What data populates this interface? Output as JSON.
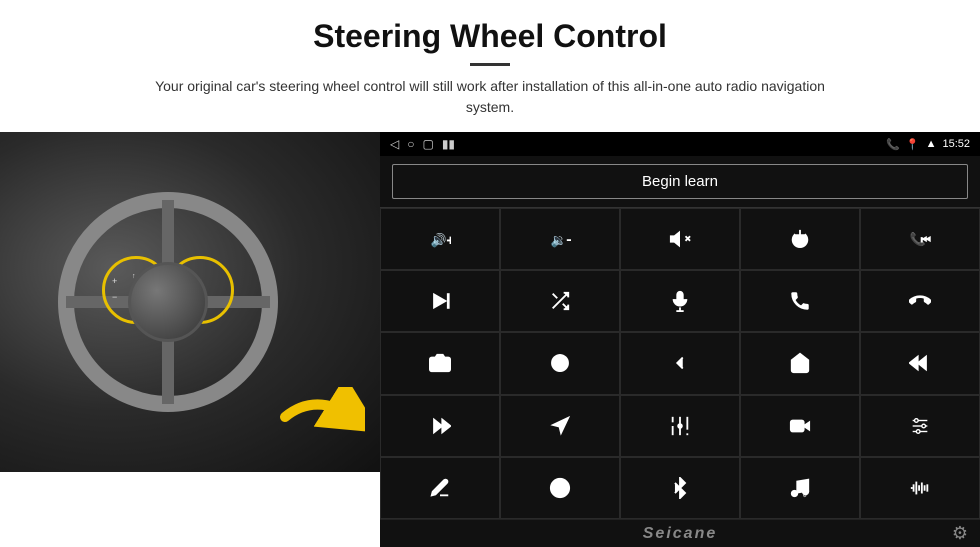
{
  "header": {
    "title": "Steering Wheel Control",
    "subtitle": "Your original car's steering wheel control will still work after installation of this all-in-one auto radio navigation system."
  },
  "status_bar": {
    "time": "15:52",
    "phone_icon": "📞",
    "location_icon": "📍",
    "wifi_icon": "📶"
  },
  "begin_learn": {
    "label": "Begin learn"
  },
  "controls": [
    {
      "id": "vol-up",
      "icon": "vol_up"
    },
    {
      "id": "vol-down",
      "icon": "vol_down"
    },
    {
      "id": "mute",
      "icon": "mute"
    },
    {
      "id": "power",
      "icon": "power"
    },
    {
      "id": "prev-track",
      "icon": "prev_track"
    },
    {
      "id": "next-track",
      "icon": "next_track"
    },
    {
      "id": "shuffle",
      "icon": "shuffle"
    },
    {
      "id": "mic",
      "icon": "mic"
    },
    {
      "id": "phone",
      "icon": "phone"
    },
    {
      "id": "hang-up",
      "icon": "hang_up"
    },
    {
      "id": "camera",
      "icon": "camera"
    },
    {
      "id": "rotate-360",
      "icon": "rotate_360"
    },
    {
      "id": "back",
      "icon": "back"
    },
    {
      "id": "home",
      "icon": "home"
    },
    {
      "id": "skip-back",
      "icon": "skip_back"
    },
    {
      "id": "fast-forward",
      "icon": "fast_forward"
    },
    {
      "id": "navigate",
      "icon": "navigate"
    },
    {
      "id": "equalizer",
      "icon": "equalizer"
    },
    {
      "id": "record",
      "icon": "record"
    },
    {
      "id": "settings-eq",
      "icon": "settings_eq"
    },
    {
      "id": "pen",
      "icon": "pen"
    },
    {
      "id": "circle-dot",
      "icon": "circle_dot"
    },
    {
      "id": "bluetooth",
      "icon": "bluetooth"
    },
    {
      "id": "music",
      "icon": "music"
    },
    {
      "id": "waveform",
      "icon": "waveform"
    }
  ],
  "bottom_bar": {
    "logo": "Seicane",
    "gear_label": "⚙"
  }
}
